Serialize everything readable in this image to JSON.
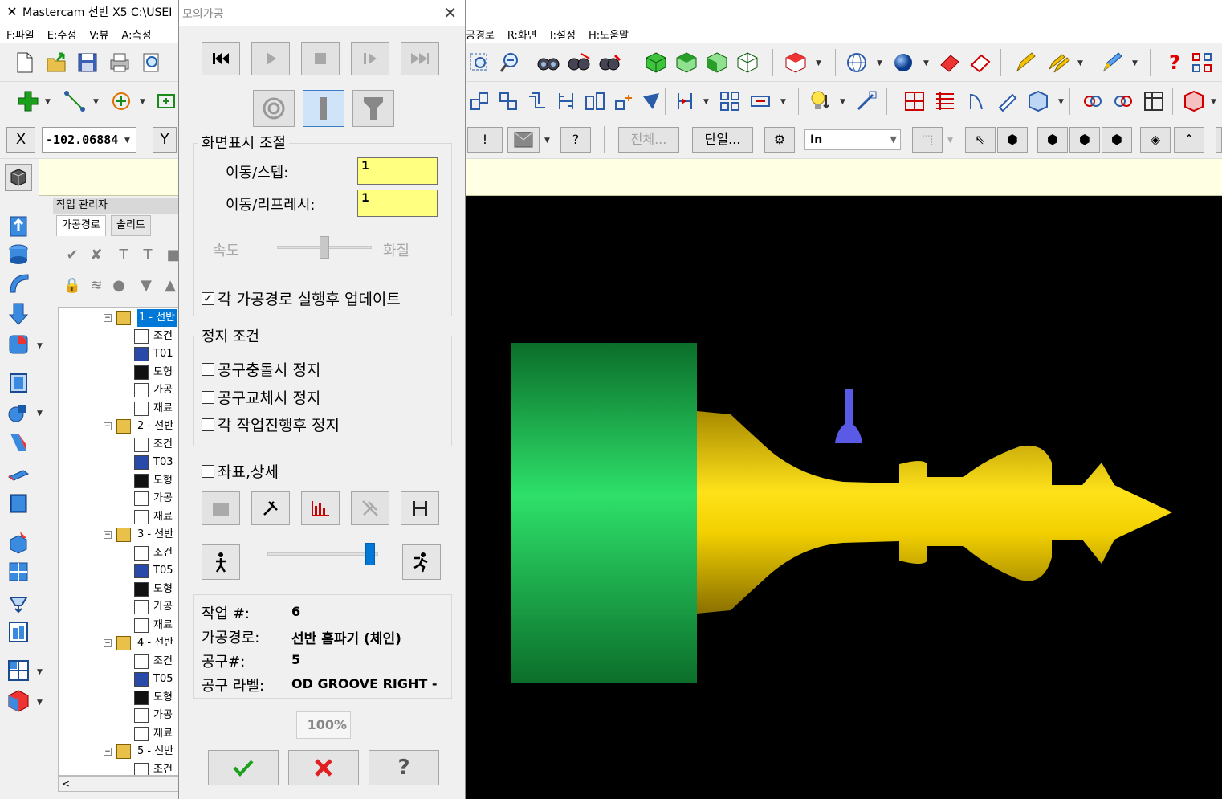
{
  "app": {
    "title": "Mastercam 선반 X5   C:\\USEI",
    "menus": [
      "F:파일",
      "E:수정",
      "V:뷰",
      "A:측정"
    ],
    "menus_right": [
      "공경로",
      "R:화면",
      "I:설정",
      "H:도움말"
    ]
  },
  "coords": {
    "x_label": "X",
    "x_value": "-102.06884",
    "y_label": "Y"
  },
  "toolbar3": {
    "all_button": "전체...",
    "single_button": "단일...",
    "units": "In"
  },
  "ops_manager": {
    "title": "작업 관리자",
    "tabs": [
      "가공경로",
      "솔리드"
    ],
    "operations": [
      {
        "name": "1 - 선반",
        "children": [
          "조건",
          "T01",
          "도형",
          "가공",
          "재료"
        ]
      },
      {
        "name": "2 - 선반",
        "children": [
          "조건",
          "T03",
          "도형",
          "가공",
          "재료"
        ]
      },
      {
        "name": "3 - 선반",
        "children": [
          "조건",
          "T05",
          "도형",
          "가공",
          "재료"
        ]
      },
      {
        "name": "4 - 선반",
        "children": [
          "조건",
          "T05",
          "도형",
          "가공",
          "재료"
        ]
      },
      {
        "name": "5 - 선반",
        "children": [
          "조건"
        ]
      }
    ],
    "scroll_left": "<"
  },
  "dialog": {
    "title": "모의가공",
    "display_group": "화면표시 조절",
    "step_label": "이동/스텝:",
    "step_value": "1",
    "refresh_label": "이동/리프레시:",
    "refresh_value": "1",
    "speed_label": "속도",
    "quality_label": "화질",
    "update_each": "각 가공경로 실행후 업데이트",
    "update_each_checked": true,
    "stop_group": "정지 조건",
    "stop_collision": "공구충돌시 정지",
    "stop_toolchange": "공구교체시 정지",
    "stop_each_op": "각 작업진행후 정지",
    "coord_detail": "좌표,상세",
    "info": {
      "op_label": "작업 #:",
      "op_value": "6",
      "toolpath_label": "가공경로:",
      "toolpath_value": "선반 홈파기 (체인)",
      "tool_label": "공구#:",
      "tool_value": "5",
      "tool_name_label": "공구 라벨:",
      "tool_name_value": "OD GROOVE RIGHT -"
    },
    "progress_percent": "100%",
    "speed_slider_level": 0.5,
    "run_speed_level": 0.93
  },
  "colors": {
    "stock_green": "#1f9a3c",
    "part_yellow": "#e2c000",
    "tool_blue": "#5a5ae6",
    "viewport_bg": "#000000",
    "highlight_blue": "#0078d7"
  }
}
